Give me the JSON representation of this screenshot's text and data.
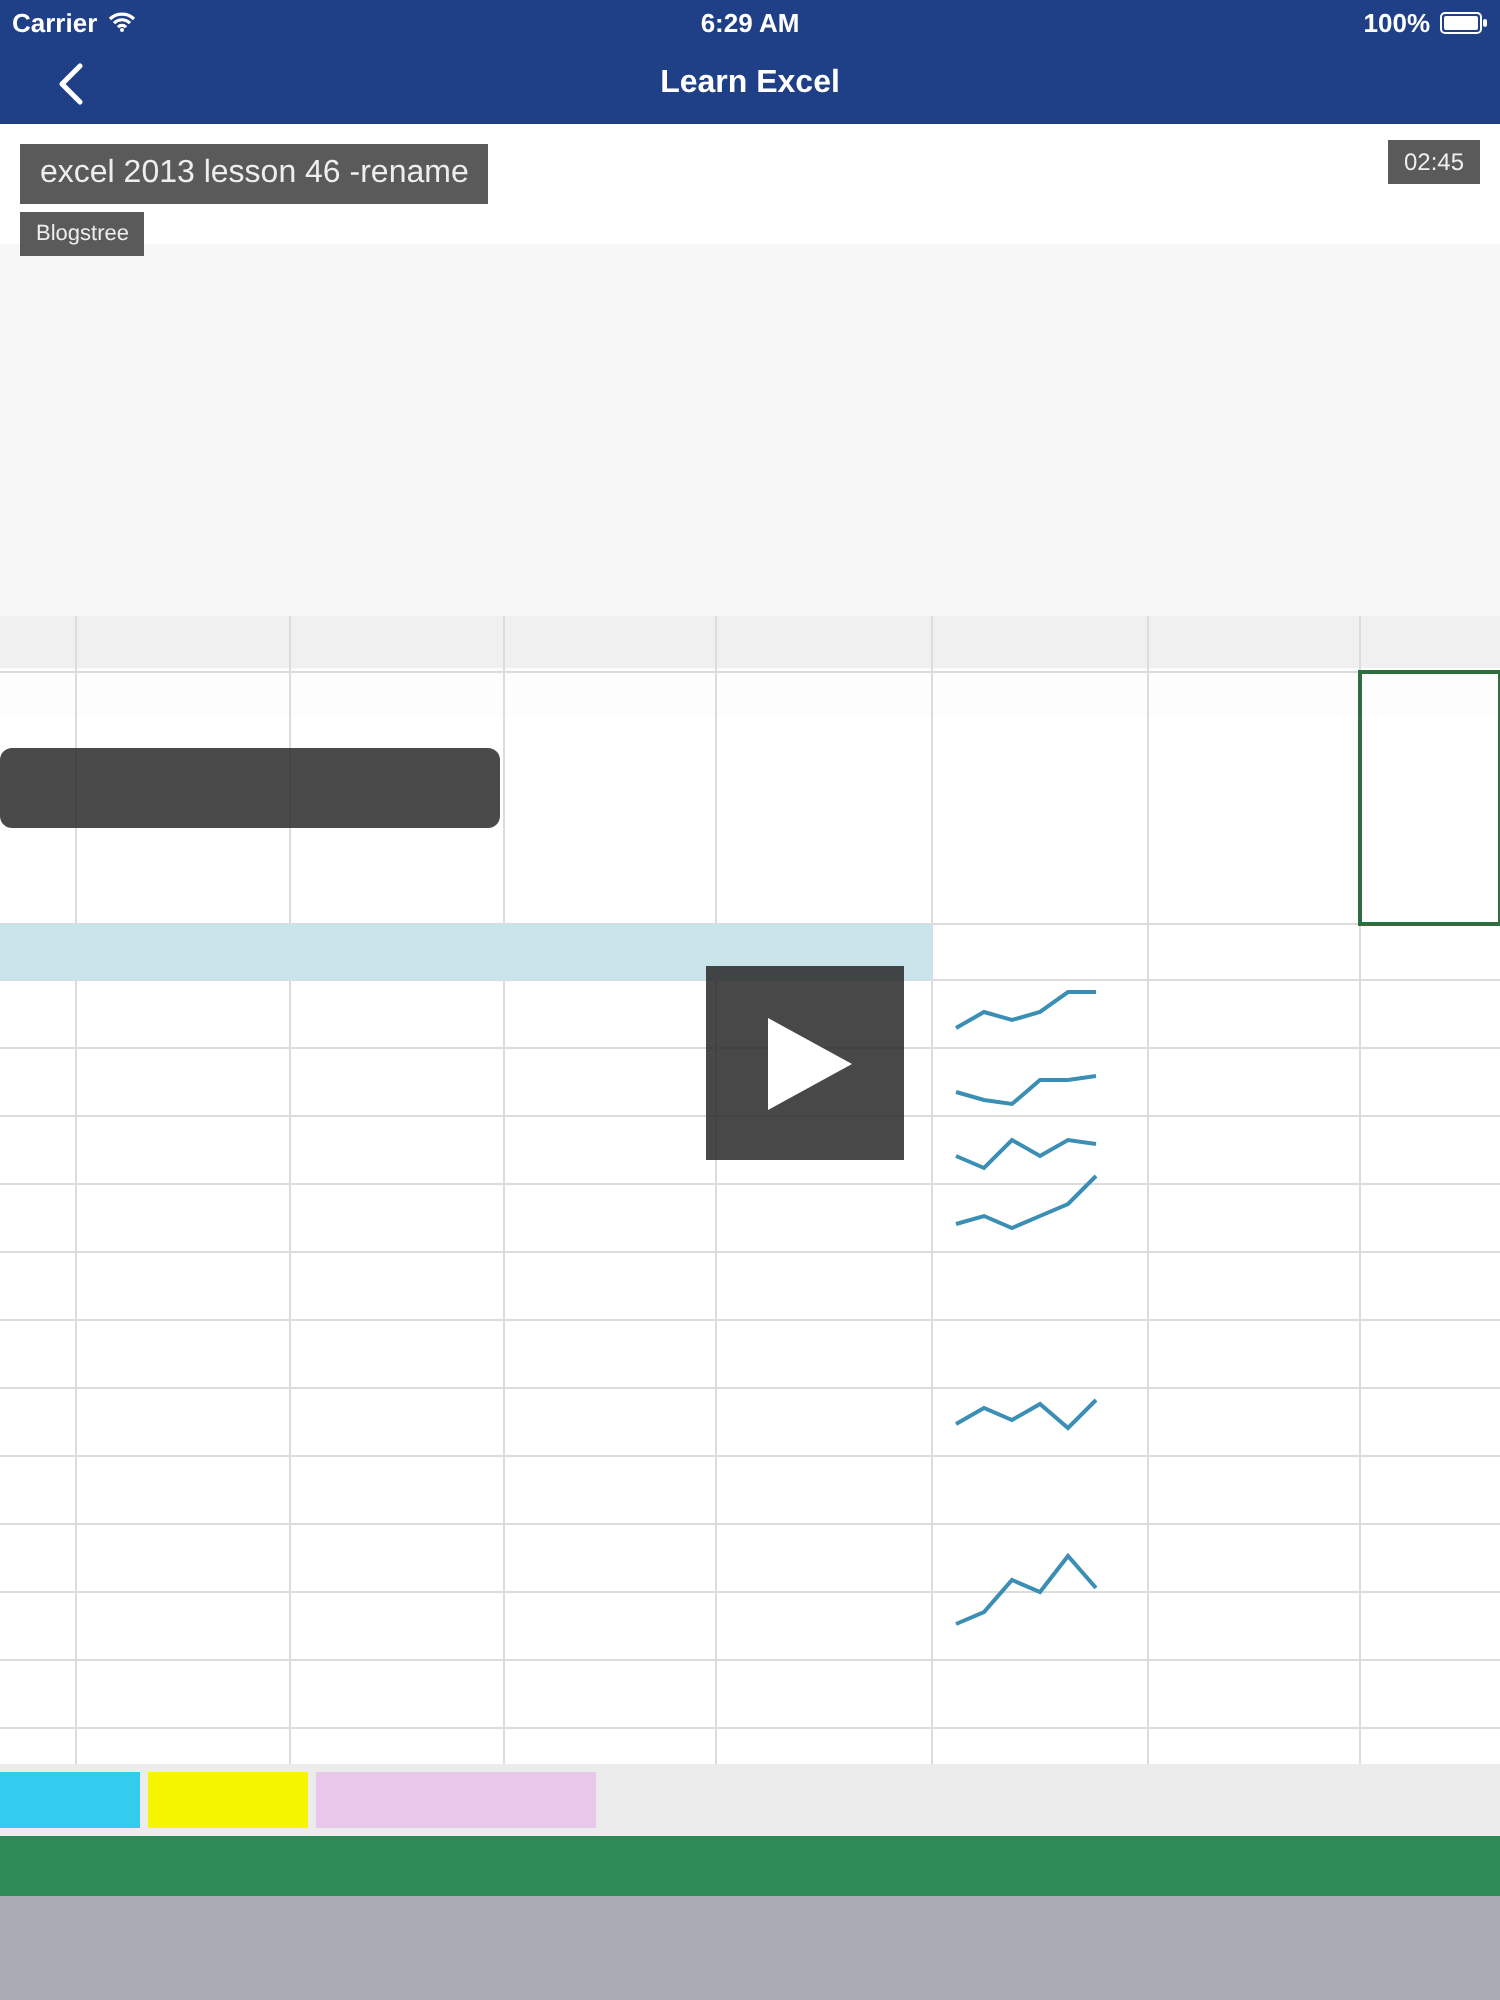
{
  "status_bar": {
    "carrier": "Carrier",
    "time": "6:29 AM",
    "battery": "100%"
  },
  "nav_bar": {
    "title": "Learn Excel"
  },
  "video": {
    "kind": "picture",
    "title": "excel 2013 lesson 46 -rename",
    "channel": "Blogstree",
    "duration": "02:45"
  }
}
